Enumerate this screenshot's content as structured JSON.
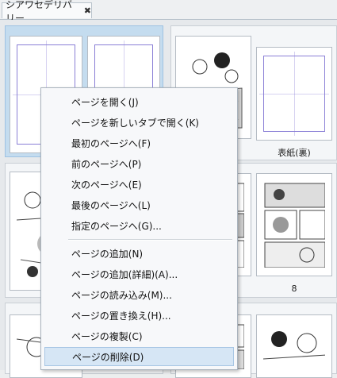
{
  "tab": {
    "title": "シアワセデリバリー",
    "close_icon": "close-icon"
  },
  "pages": {
    "cover_back_caption": "表紙(裏)",
    "page8_caption": "8"
  },
  "context_menu": {
    "items": [
      {
        "label": "ページを開く(J)"
      },
      {
        "label": "ページを新しいタブで開く(K)"
      },
      {
        "label": "最初のページへ(F)"
      },
      {
        "label": "前のページへ(P)"
      },
      {
        "label": "次のページへ(E)"
      },
      {
        "label": "最後のページへ(L)"
      },
      {
        "label": "指定のページへ(G)..."
      },
      {
        "label": "ページの追加(N)"
      },
      {
        "label": "ページの追加(詳細)(A)..."
      },
      {
        "label": "ページの読み込み(M)..."
      },
      {
        "label": "ページの置き換え(H)..."
      },
      {
        "label": "ページの複製(C)"
      },
      {
        "label": "ページの削除(D)"
      }
    ],
    "highlighted_index": 12
  }
}
